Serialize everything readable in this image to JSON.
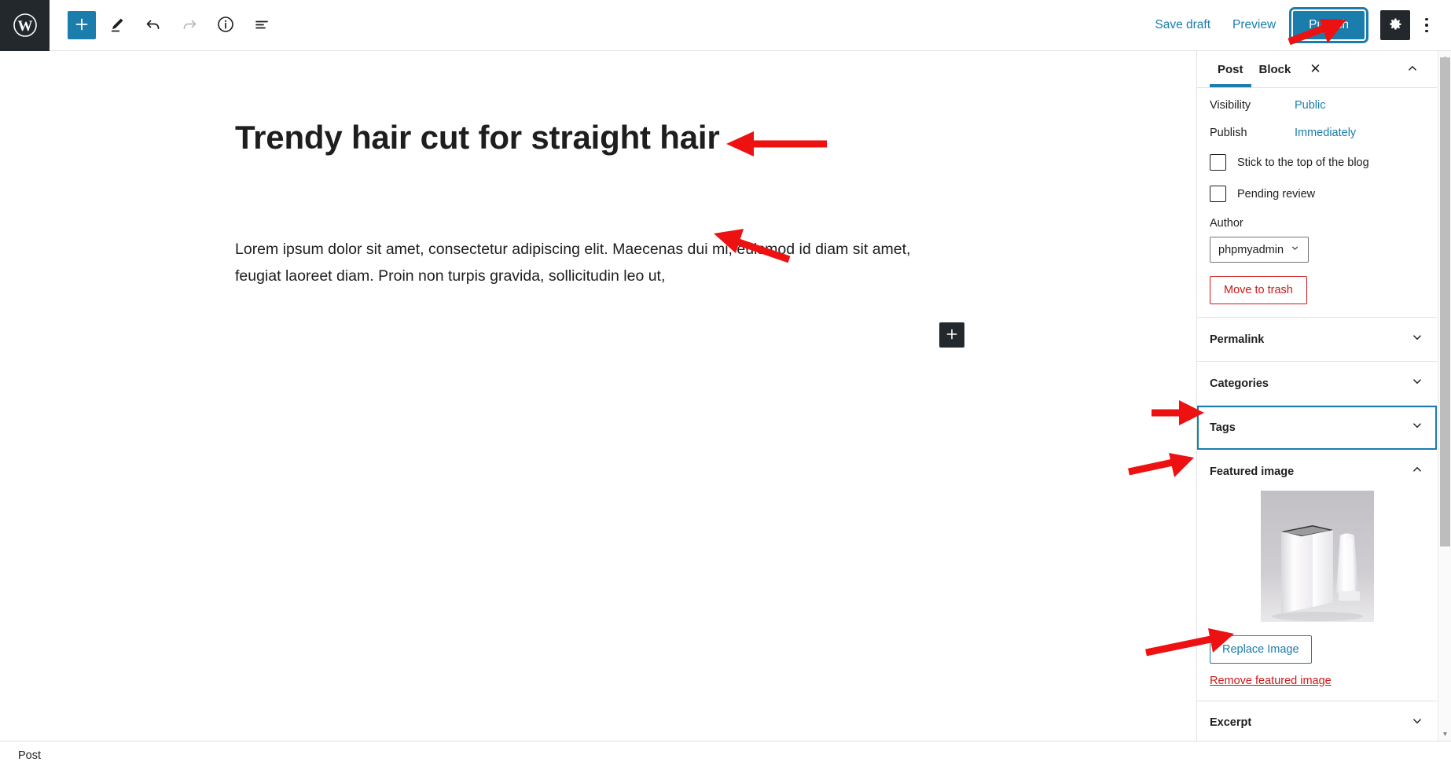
{
  "toolbar": {
    "logo_icon": "wordpress-logo-icon",
    "add_block_label": "+",
    "add_block_icon": "plus-icon",
    "edit_icon": "pencil-icon",
    "undo_icon": "undo-arrow-icon",
    "redo_icon": "redo-arrow-icon",
    "info_icon": "info-circle-icon",
    "list_view_icon": "list-view-icon",
    "save_draft_label": "Save draft",
    "preview_label": "Preview",
    "publish_label": "Publish",
    "settings_icon": "gear-icon",
    "more_options_icon": "kebab-menu-icon"
  },
  "editor": {
    "post_title": "Trendy hair cut for straight hair",
    "paragraph": "Lorem ipsum dolor sit amet, consectetur adipiscing elit. Maecenas dui mi, euismod id diam sit amet, feugiat laoreet diam. Proin non turpis gravida, sollicitudin leo ut,",
    "block_inserter_label": "+",
    "block_inserter_icon": "plus-icon"
  },
  "sidebar": {
    "tabs": [
      {
        "label": "Post",
        "active": true
      },
      {
        "label": "Block",
        "active": false
      }
    ],
    "close_label": "✕",
    "close_icon": "close-icon",
    "collapse_icon": "chevron-up-icon",
    "status_panel": {
      "visibility_label": "Visibility",
      "visibility_value": "Public",
      "publish_label": "Publish",
      "publish_value": "Immediately",
      "sticky_label": "Stick to the top of the blog",
      "sticky_checked": false,
      "pending_label": "Pending review",
      "pending_checked": false,
      "author_label": "Author",
      "author_value": "phpmyadmin",
      "author_caret_icon": "chevron-down-icon",
      "trash_label": "Move to trash"
    },
    "panels": [
      {
        "label": "Permalink",
        "icon": "chevron-down-icon",
        "focused": false
      },
      {
        "label": "Categories",
        "icon": "chevron-down-icon",
        "focused": false
      },
      {
        "label": "Tags",
        "icon": "chevron-down-icon",
        "focused": true
      }
    ],
    "featured_image": {
      "label": "Featured image",
      "toggle_icon": "chevron-up-icon",
      "thumb_icon": "product-packaging-photo",
      "replace_label": "Replace Image",
      "remove_label": "Remove featured image"
    },
    "excerpt": {
      "label": "Excerpt",
      "icon": "chevron-down-icon"
    },
    "scrollbar": {
      "up_icon": "scroll-up-arrow-icon",
      "down_icon": "scroll-down-arrow-icon"
    }
  },
  "statusbar": {
    "breadcrumb": "Post"
  },
  "colors": {
    "accent_blue": "#1a7dab",
    "dark": "#23282d",
    "danger_red": "#cc1818",
    "annotation_red": "#ee1111"
  },
  "annotations": [
    {
      "name": "arrow-to-title",
      "points_to": "post-title"
    },
    {
      "name": "arrow-to-paragraph",
      "points_to": "post-paragraph"
    },
    {
      "name": "arrow-to-publish",
      "points_to": "publish-button"
    },
    {
      "name": "arrow-to-categories",
      "points_to": "panel-categories"
    },
    {
      "name": "arrow-to-tags",
      "points_to": "panel-tags"
    },
    {
      "name": "arrow-to-featured-image",
      "points_to": "featured-image-thumbnail"
    }
  ]
}
